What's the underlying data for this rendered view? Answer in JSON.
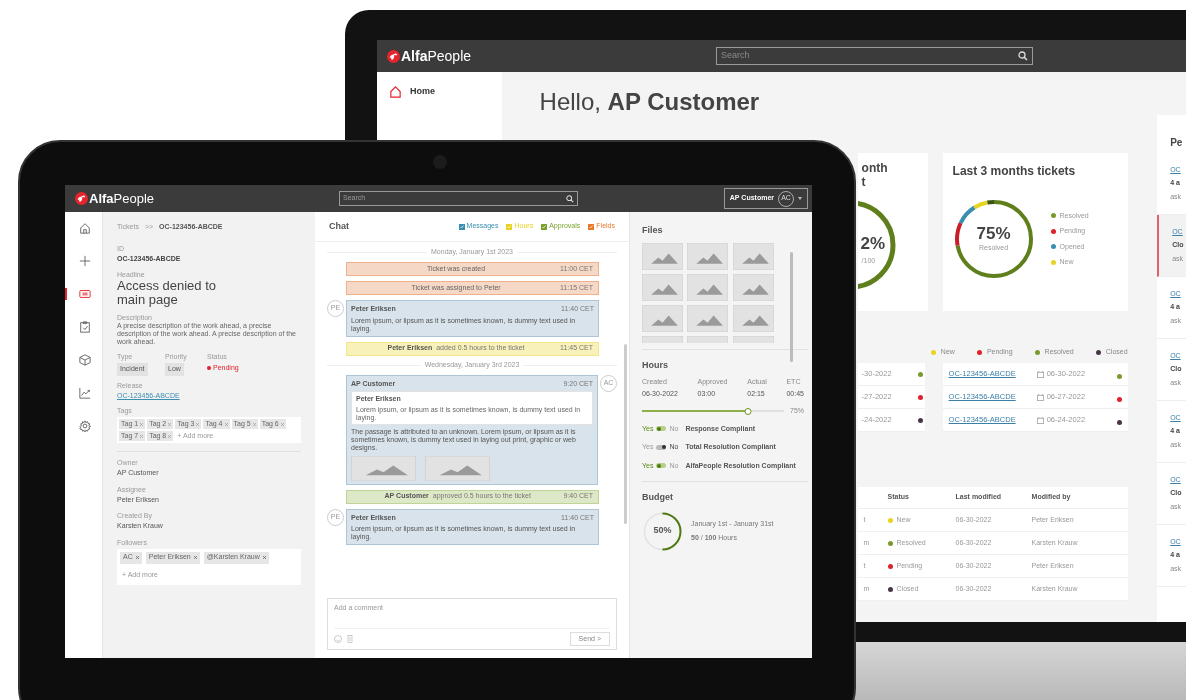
{
  "laptop": {
    "header": {
      "logo": "**Alfa**People",
      "search": {
        "placeholder": "Search"
      }
    },
    "sidebar": {
      "items": [
        {
          "label": "Home",
          "selected": true
        }
      ]
    },
    "greeting": "Hello, **AP Customer**",
    "card_partial": {
      "title_fragments": [
        "onth",
        "t"
      ],
      "value": "2%",
      "caption": "/100"
    },
    "card": {
      "title": "Last 3 months tickets",
      "value": "75%",
      "caption": "Resolved",
      "legend": [
        {
          "label": "Resolved",
          "color": "#7a9a2e"
        },
        {
          "label": "Pending",
          "color": "#e0202a"
        },
        {
          "label": "Opened",
          "color": "#3a8fb0"
        },
        {
          "label": "New",
          "color": "#e8d320"
        }
      ]
    },
    "status_legend": [
      {
        "label": "New",
        "color": "#e8d320"
      },
      {
        "label": "Pending",
        "color": "#e0202a"
      },
      {
        "label": "Resolved",
        "color": "#7a9a2e"
      },
      {
        "label": "Closed",
        "color": "#4a3548"
      }
    ],
    "date_table_partial": {
      "rows": [
        {
          "date": "-30-2022",
          "color": "#7a9a2e"
        },
        {
          "date": "-27-2022",
          "color": "#e0202a"
        },
        {
          "date": "-24-2022",
          "color": "#4a3548"
        }
      ]
    },
    "date_table": {
      "rows": [
        {
          "ticket": "OC-123456-ABCDE",
          "date": "06-30-2022",
          "color": "#7a9a2e"
        },
        {
          "ticket": "OC-123456-ABCDE",
          "date": "06-27-2022",
          "color": "#e0202a"
        },
        {
          "ticket": "OC-123456-ABCDE",
          "date": "06-24-2022",
          "color": "#4a3548"
        }
      ]
    },
    "table": {
      "columns": [
        "Status",
        "Last modified",
        "Modified by"
      ],
      "rows": [
        {
          "column_1": "t",
          "status": "New",
          "color": "#e8d320",
          "last_modified": "06-30-2022",
          "modified_by": "Peter Eriksen"
        },
        {
          "column_1": "m",
          "status": "Resolved",
          "color": "#7a9a2e",
          "last_modified": "06-30-2022",
          "modified_by": "Karsten Krauw"
        },
        {
          "column_1": "t",
          "status": "Pending",
          "color": "#e0202a",
          "last_modified": "06-30-2022",
          "modified_by": "Peter Eriksen"
        },
        {
          "column_1": "m",
          "status": "Closed",
          "color": "#4a3548",
          "last_modified": "06-30-2022",
          "modified_by": "Karsten Krauw"
        }
      ]
    },
    "right_panel": {
      "title": "Pe",
      "items": [
        {
          "link": "OC",
          "line_2": "4 a",
          "line_3": "ask",
          "selected": false
        },
        {
          "link": "OC",
          "line_2": "Clo",
          "line_3": "ask",
          "selected": true
        },
        {
          "link": "OC",
          "line_2": "4 a",
          "line_3": "ask",
          "selected": false
        },
        {
          "link": "OC",
          "line_2": "Clo",
          "line_3": "ask",
          "selected": false
        },
        {
          "link": "OC",
          "line_2": "4 a",
          "line_3": "ask",
          "selected": false
        },
        {
          "link": "OC",
          "line_2": "Clo",
          "line_3": "ask",
          "selected": false
        },
        {
          "link": "OC",
          "line_2": "4 a",
          "line_3": "ask",
          "selected": false
        }
      ]
    }
  },
  "tablet": {
    "header": {
      "logo": "**Alfa**People",
      "search": {
        "placeholder": "Search"
      },
      "user": {
        "name": "AP Customer",
        "initials": "AC"
      }
    },
    "rail": [
      {
        "kind": "home",
        "selected": false
      },
      {
        "kind": "plus",
        "selected": false
      },
      {
        "kind": "ticket",
        "selected": true
      },
      {
        "kind": "clipboard",
        "selected": false
      },
      {
        "kind": "box",
        "selected": false
      },
      {
        "kind": "chart",
        "selected": false
      },
      {
        "kind": "settings",
        "selected": false
      }
    ],
    "details": {
      "breadcrumb": {
        "parent": "Tickets",
        "separator": ">>",
        "current": "OC-123456-ABCDE"
      },
      "id": {
        "label": "ID",
        "value": "OC-123456-ABCDE"
      },
      "headline": {
        "label": "Headline",
        "value": "Access denied to main page"
      },
      "description": {
        "label": "Description",
        "value": "A precise description of the work ahead, a precise description of the work ahead. A precise description of the work ahead."
      },
      "type": {
        "label": "Type",
        "value": "Incident"
      },
      "priority": {
        "label": "Priority",
        "value": "Low"
      },
      "status": {
        "label": "Status",
        "value": "Pending",
        "color": "#e0202a"
      },
      "release": {
        "label": "Release",
        "link": "OC-123456-ABCDE"
      },
      "tags": {
        "label": "Tags",
        "items": [
          "Tag 1",
          "Tag 2",
          "Tag 3",
          "Tag 4",
          "Tag 5",
          "Tag 6",
          "Tag 7",
          "Tag 8"
        ],
        "add_more": "+ Add more"
      },
      "people": [
        {
          "label": "Owner",
          "value": "AP Customer"
        },
        {
          "label": "Assignee",
          "value": "Peter Eriksen"
        },
        {
          "label": "Created By",
          "value": "Karsten Krauw"
        }
      ],
      "followers": {
        "label": "Followers",
        "items": [
          "AC",
          "Peter Eriksen",
          "@Karsten Krauw"
        ],
        "add_more": "+ Add more"
      }
    },
    "chat": {
      "title": "Chat",
      "filters": [
        {
          "label": "Messages",
          "color": "#3a8fb0",
          "checked": true
        },
        {
          "label": "Hours",
          "color": "#e8d320",
          "checked": true
        },
        {
          "label": "Approvals",
          "color": "#7aa32e",
          "checked": true
        },
        {
          "label": "Fields",
          "color": "#e8782a",
          "checked": true
        }
      ],
      "entries": [
        {
          "kind": "date",
          "text": "Monday, January 1st 2023"
        },
        {
          "kind": "event",
          "text": "Ticket was created",
          "time": "11:00 CET"
        },
        {
          "kind": "event",
          "text": "Ticket was assigned to Peter",
          "time": "11:15 CET"
        },
        {
          "kind": "message",
          "initials": "PE",
          "author": "Peter Eriksen",
          "time": "11:40 CET",
          "text": "Lorem ipsum, or lipsum as it is sometimes known, is dummy text used in laying."
        },
        {
          "kind": "hours",
          "author": "Peter Eriksen",
          "text": "added 0.5 hours to the ticket",
          "time": "11:45 CET"
        },
        {
          "kind": "date",
          "text": "Wednesday, January 3rd 2023"
        },
        {
          "kind": "reply",
          "initials": "AC",
          "author": "AP Customer",
          "time": "9:20 CET",
          "quote": {
            "author": "Peter Eriksen",
            "text": "Lorem ipsum, or lipsum as it is sometimes known, is dummy text used in laying."
          },
          "text": "The passage is attributed to an unknown. Lorem ipsum, or lipsum as it is sometimes known, is dummy text used in laying out print, graphic or web designs."
        },
        {
          "kind": "approval",
          "author": "AP Customer",
          "text": "approved 0.5 hours to the ticket",
          "time": "9:40 CET"
        },
        {
          "kind": "message",
          "initials": "PE",
          "author": "Peter Eriksen",
          "time": "11:40 CET",
          "text": "Lorem ipsum, or lipsum as it is sometimes known, is dummy text used in laying."
        }
      ],
      "composer": {
        "placeholder": "Add a comment",
        "send": "Send >"
      }
    },
    "side": {
      "files": {
        "title": "Files"
      },
      "hours": {
        "title": "Hours",
        "stats": [
          {
            "label": "Created",
            "value": "06-30-2022"
          },
          {
            "label": "Approved",
            "value": "03:00"
          },
          {
            "label": "Actual",
            "value": "02:15"
          },
          {
            "label": "ETC",
            "value": "00:45"
          }
        ],
        "progress": {
          "level": 0.75,
          "reading": "75%"
        },
        "compliance": [
          {
            "yes": "Yes",
            "no": "No",
            "on": true,
            "label": "Response Compliant"
          },
          {
            "yes": "Yes",
            "no": "No",
            "on": false,
            "label": "Total Resolution Compliant"
          },
          {
            "yes": "Yes",
            "no": "No",
            "on": true,
            "label": "AlfaPeople Resolution Compliant"
          }
        ]
      },
      "budget": {
        "title": "Budget",
        "value": "50%",
        "level": 0.5,
        "period": "January 1st - January 31st",
        "amount": "**50** / **100** Hours"
      }
    }
  }
}
